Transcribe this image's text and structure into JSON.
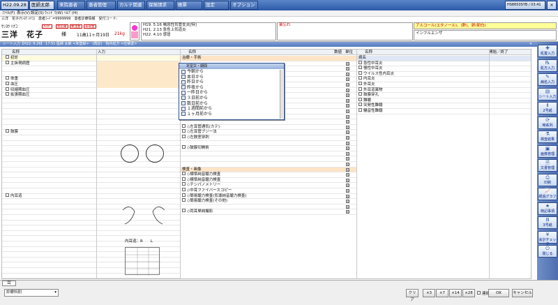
{
  "topbar": {
    "date": "H22.09.28",
    "doctor": "医師太郎",
    "btn_inpatient": "来院患者",
    "btn_patient_mgmt": "患者管理",
    "btn_forms": "カルテ関連",
    "btn_insurance": "保険請求",
    "btn_ledger": "帳票",
    "btn_settings": "設定",
    "btn_options": "オプション",
    "clock": "HS8650SYB / 03:41"
  },
  "menubar": {
    "items": [
      "ﾌｧｲﾙ(F)",
      "表示(V)",
      "設定(S)",
      "ｳｨﾝﾄﾞｳ(W)",
      "ﾍﾙﾌﾟ(H)"
    ]
  },
  "patient": {
    "kana": "ｻﾝﾖｳ ﾊﾅｺ",
    "name": "三洋　花子",
    "honorific": "様",
    "age": "11歳11ヶ月19日",
    "weight": "21kg",
    "info_line": "三洋　花子(ｻﾝﾖｳ ﾊﾅｺ)　患者ｺｰﾄﾞ=9999999　患者診療情報　受付コード:",
    "tags": [
      "ｱﾚﾙｷﾞ",
      "禁忌薬",
      "要注意",
      "未収金"
    ],
    "history": [
      "H19. 5.16 喘息性気管支炎[特]",
      "H21. 2.13 急性上気道炎",
      "H22. 4.10 感冒"
    ],
    "memo_label": "薬忘れ",
    "allergy": "アルコール(エタノール)、(酢)、卵(卵白)",
    "disease": "インフルエンザ"
  },
  "sheetbar": {
    "title": "シート入力【H22. 9.29】 17:51 医師 太郎 <未登録>　(再診)　院内処方 <仕様変>"
  },
  "grid": {
    "left_header": {
      "name": "名称",
      "input": "入力"
    },
    "left_rows": [
      "初診",
      "主訴現病歴",
      "",
      "",
      "体重",
      "血圧",
      "収縮期血圧",
      "拡張期血圧",
      "",
      "",
      "",
      "",
      "",
      "",
      "鼓膜",
      "",
      "",
      "",
      "",
      "",
      "",
      "",
      "",
      "",
      "",
      "",
      "内耳道",
      "",
      "",
      "",
      "",
      "",
      "",
      "",
      "",
      "",
      "",
      "",
      "",
      "",
      "",
      "",
      "",
      "耳ﾉｰﾄ診所見"
    ],
    "mid_header": {
      "name": "名称",
      "qty": "数値",
      "unit": "単位"
    },
    "mid_rows": [
      "治療・手術",
      "",
      "",
      "",
      "",
      "",
      "",
      "",
      "",
      "",
      "",
      "",
      "",
      "◇左耳管通気(カテ)",
      "◇左耳管ブジー法",
      "◇左鼓室穿刺",
      "",
      "◇鼓膜切開術",
      "",
      "",
      "",
      "検査・画像",
      "◇標準純音聴力検査",
      "◇標準純音聴力検査",
      "◇チンパノメトリー",
      "◇中耳ファイバースコピー",
      "◇簡易聴力検査(気導純音聴力検査)",
      "◇簡易聴力検査(その他)",
      "",
      "◇両耳単純撮影"
    ],
    "right_header": {
      "name": "名称",
      "start": "開始／終了"
    },
    "right_rows": [
      "病名",
      "急性中耳炎",
      "慢性中耳炎",
      "ウイルス性内耳炎",
      "内耳炎",
      "外耳炎",
      "外耳道異物",
      "鼓膜穿孔",
      "難聴",
      "突発性難聴",
      "騒音性難聴"
    ],
    "inner_ear_label": "内耳道：R　　L"
  },
  "popup": {
    "title": "定型文・期間",
    "items": [
      "今朝から",
      "本日から",
      "昨日から",
      "昨夜から",
      "一昨日から",
      "３日前から",
      "数日前から",
      "１週間前から",
      "１ヶ月前から"
    ]
  },
  "sidebar": {
    "items": [
      "処置入力",
      "処方入力",
      "病名入力",
      "シート入力",
      "2号紙",
      "時系列",
      "検査結果",
      "画像管理",
      "文書管理",
      "印刷",
      "経過グラフ",
      "特記事項",
      "3号紙",
      "会計チェック",
      "閉じる"
    ]
  },
  "bottom": {
    "tab": "耳",
    "select": "診療科別",
    "btn_clear": "クリア",
    "btn_x3": "×3",
    "btn_x7": "×7",
    "btn_x14": "×14",
    "btn_x28": "×28",
    "continuous": "連続",
    "btn_ok": "OK",
    "btn_cancel": "キャンセル"
  }
}
